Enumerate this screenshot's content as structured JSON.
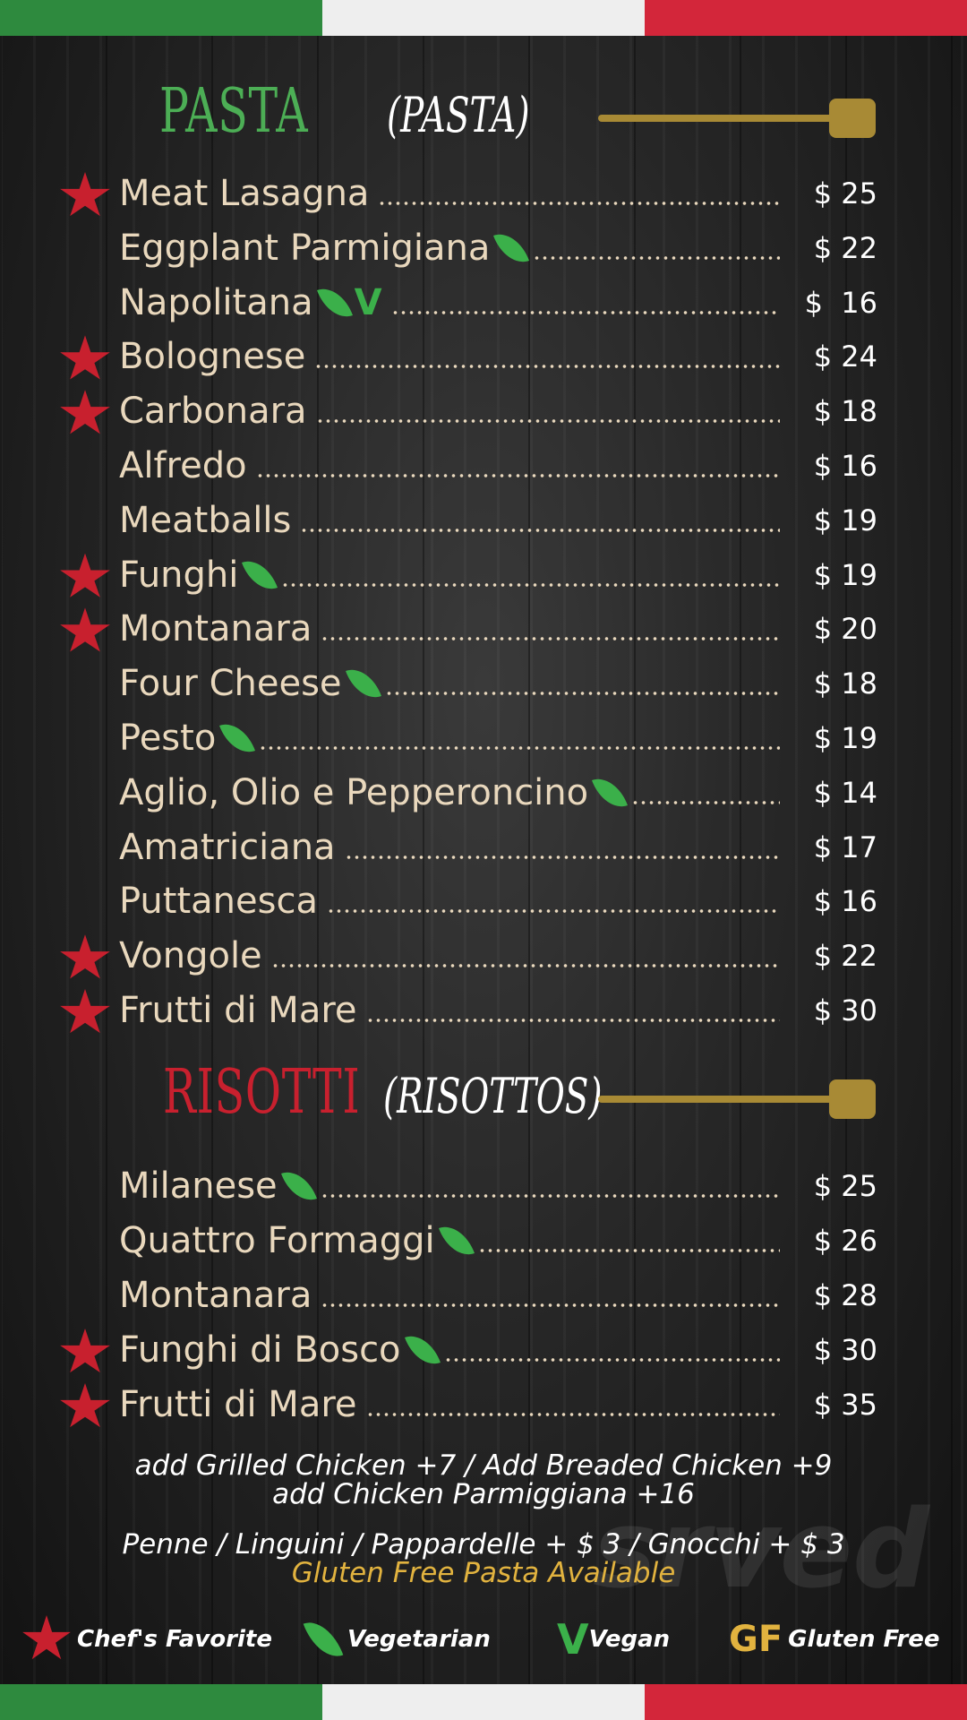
{
  "colors": {
    "flag_green": "#2e8a3e",
    "flag_white": "#eeeeee",
    "flag_red": "#d3263a",
    "pasta_title": "#4cae55",
    "risotti_title": "#c8202e",
    "item_text": "#e9d8bd",
    "price_text": "#ffffff",
    "spoon_gold": "#a88a35",
    "gluten_free_text": "#e2b33f"
  },
  "pasta": {
    "title": "PASTA",
    "subtitle": "(PASTA)",
    "items": [
      {
        "name": "Meat Lasagna",
        "price": "$ 25",
        "favorite": true,
        "vegetarian": false,
        "vegan": false
      },
      {
        "name": "Eggplant Parmigiana",
        "price": "$ 22",
        "favorite": false,
        "vegetarian": true,
        "vegan": false
      },
      {
        "name": "Napolitana",
        "price": "$  16",
        "favorite": false,
        "vegetarian": true,
        "vegan": true
      },
      {
        "name": "Bolognese",
        "price": "$ 24",
        "favorite": true,
        "vegetarian": false,
        "vegan": false
      },
      {
        "name": "Carbonara",
        "price": "$ 18",
        "favorite": true,
        "vegetarian": false,
        "vegan": false
      },
      {
        "name": "Alfredo",
        "price": "$ 16",
        "favorite": false,
        "vegetarian": false,
        "vegan": false
      },
      {
        "name": "Meatballs",
        "price": "$ 19",
        "favorite": false,
        "vegetarian": false,
        "vegan": false
      },
      {
        "name": "Funghi",
        "price": "$ 19",
        "favorite": true,
        "vegetarian": true,
        "vegan": false
      },
      {
        "name": "Montanara",
        "price": "$ 20",
        "favorite": true,
        "vegetarian": false,
        "vegan": false
      },
      {
        "name": "Four Cheese",
        "price": "$ 18",
        "favorite": false,
        "vegetarian": true,
        "vegan": false
      },
      {
        "name": "Pesto",
        "price": "$ 19",
        "favorite": false,
        "vegetarian": true,
        "vegan": false
      },
      {
        "name": "Aglio, Olio e Pepperoncino",
        "price": "$ 14",
        "favorite": false,
        "vegetarian": true,
        "vegan": false
      },
      {
        "name": "Amatriciana",
        "price": "$ 17",
        "favorite": false,
        "vegetarian": false,
        "vegan": false
      },
      {
        "name": "Puttanesca",
        "price": "$ 16",
        "favorite": false,
        "vegetarian": false,
        "vegan": false
      },
      {
        "name": "Vongole",
        "price": "$ 22",
        "favorite": true,
        "vegetarian": false,
        "vegan": false
      },
      {
        "name": "Frutti di Mare",
        "price": "$ 30",
        "favorite": true,
        "vegetarian": false,
        "vegan": false
      }
    ]
  },
  "risotti": {
    "title": "RISOTTI",
    "subtitle": "(RISOTTOS)",
    "items": [
      {
        "name": "Milanese",
        "price": "$ 25",
        "favorite": false,
        "vegetarian": true,
        "vegan": false
      },
      {
        "name": "Quattro Formaggi",
        "price": "$ 26",
        "favorite": false,
        "vegetarian": true,
        "vegan": false
      },
      {
        "name": "Montanara",
        "price": "$ 28",
        "favorite": false,
        "vegetarian": false,
        "vegan": false
      },
      {
        "name": "Funghi di Bosco",
        "price": "$ 30",
        "favorite": true,
        "vegetarian": true,
        "vegan": false
      },
      {
        "name": "Frutti di Mare",
        "price": "$ 35",
        "favorite": true,
        "vegetarian": false,
        "vegan": false
      }
    ]
  },
  "notes": {
    "chicken_line_1": "add Grilled Chicken  +7  /  Add Breaded Chicken +9",
    "chicken_line_2": "add Chicken Parmiggiana  +16",
    "pasta_options": "Penne  /  Linguini  /  Pappardelle + $ 3   /   Gnocchi + $ 3",
    "gluten_free": "Gluten Free Pasta Available"
  },
  "legend": {
    "favorite": "Chef's Favorite",
    "vegetarian": "Vegetarian",
    "vegan_mark": "V",
    "vegan": "Vegan",
    "gf_mark": "GF",
    "gluten_free": "Gluten Free"
  },
  "watermark": "srved",
  "icons": {
    "favorite": "red-star-icon",
    "vegetarian": "green-leaf-icon",
    "vegan": "green-v-icon",
    "gluten_free": "gf-icon",
    "section_divider": "spoon-icon"
  }
}
